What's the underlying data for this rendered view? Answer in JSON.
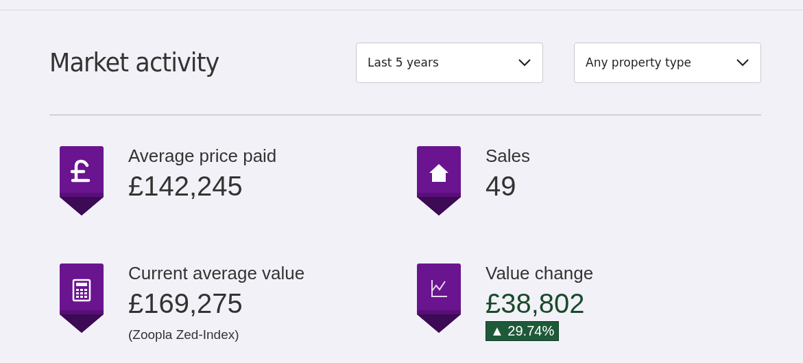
{
  "section": {
    "title": "Market activity"
  },
  "filters": [
    {
      "value": "Last 5 years"
    },
    {
      "value": "Any property type"
    }
  ],
  "stats": [
    {
      "kind": "price",
      "label": "Average price paid",
      "value": "£142,245"
    },
    {
      "kind": "sales",
      "label": "Sales",
      "value": "49"
    },
    {
      "kind": "valuation",
      "label": "Current average value",
      "value": "£169,275",
      "note": "(Zoopla Zed-Index)"
    },
    {
      "kind": "change",
      "label": "Value change",
      "value": "£38,802",
      "badge": "▲ 29.74%"
    }
  ]
}
